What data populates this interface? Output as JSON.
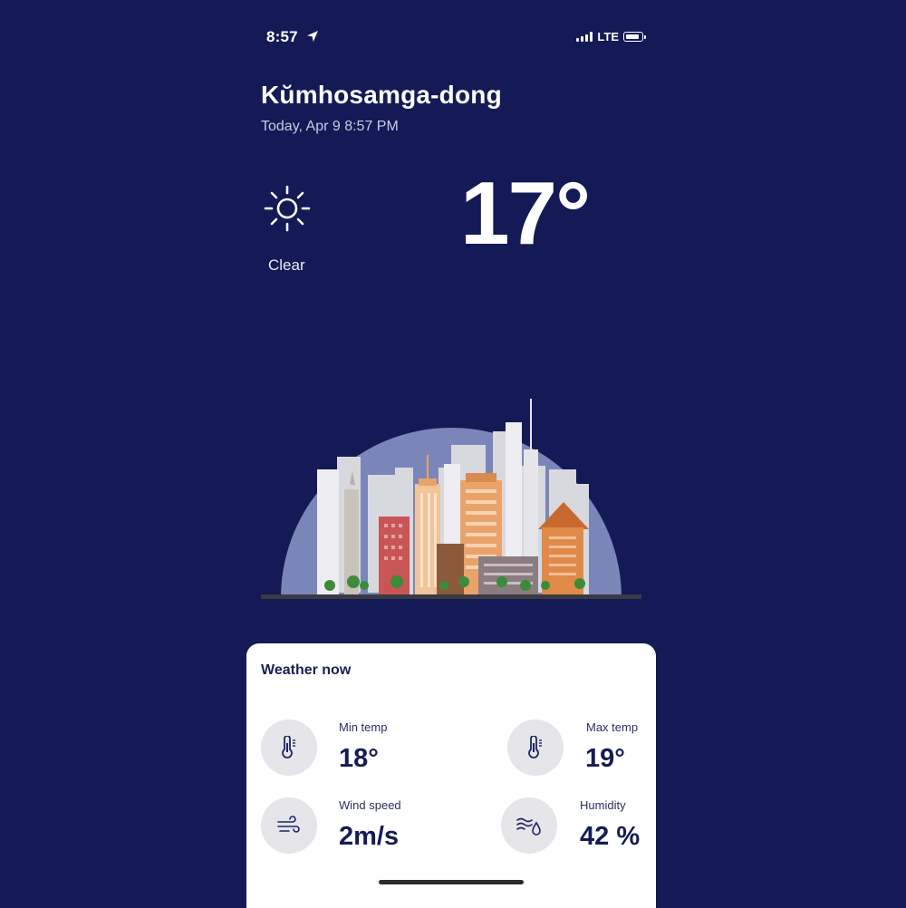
{
  "status_bar": {
    "time": "8:57",
    "network": "LTE"
  },
  "location": {
    "city": "Kŭmhosamga-dong",
    "datetime": "Today, Apr 9 8:57 PM"
  },
  "current": {
    "icon": "sun-icon",
    "condition": "Clear",
    "temperature": "17°"
  },
  "illustration": "city-skyline",
  "weather_now": {
    "title": "Weather now",
    "stats": [
      {
        "label": "Min temp",
        "value": "18°",
        "icon": "thermometer-icon"
      },
      {
        "label": "Max temp",
        "value": "19°",
        "icon": "thermometer-icon"
      },
      {
        "label": "Wind speed",
        "value": "2m/s",
        "icon": "wind-icon"
      },
      {
        "label": "Humidity",
        "value": "42 %",
        "icon": "humidity-icon"
      }
    ]
  },
  "colors": {
    "background": "#131a55",
    "card": "#ffffff",
    "sky_dome": "#7b86b8",
    "text_dark": "#161b56"
  }
}
